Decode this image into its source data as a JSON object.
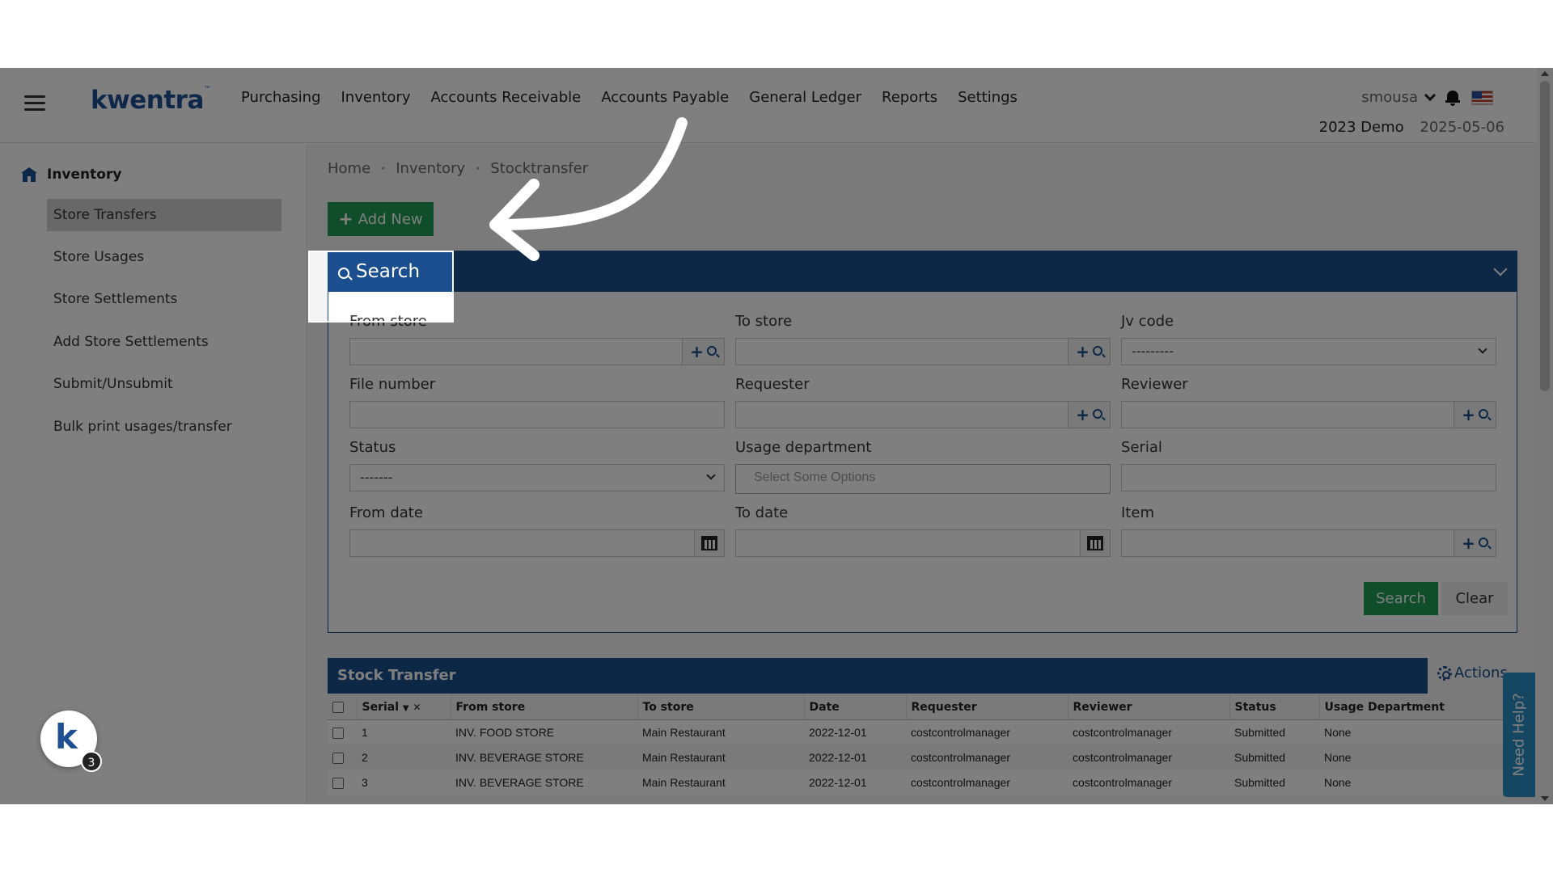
{
  "header": {
    "logo": "kwentra",
    "nav": [
      "Purchasing",
      "Inventory",
      "Accounts Receivable",
      "Accounts Payable",
      "General Ledger",
      "Reports",
      "Settings"
    ],
    "user": "smousa",
    "company": "2023 Demo",
    "date": "2025-05-06"
  },
  "sidebar": {
    "title": "Inventory",
    "items": [
      {
        "label": "Store Transfers",
        "active": true
      },
      {
        "label": "Store Usages"
      },
      {
        "label": "Store Settlements"
      },
      {
        "label": "Add Store Settlements"
      },
      {
        "label": "Submit/Unsubmit"
      },
      {
        "label": "Bulk print usages/transfer"
      }
    ]
  },
  "breadcrumb": [
    "Home",
    "Inventory",
    "Stocktransfer"
  ],
  "add_new_label": "Add New",
  "search": {
    "title": "Search",
    "fields": {
      "from_store": "From store",
      "to_store": "To store",
      "jv_code": "Jv code",
      "jv_code_value": "---------",
      "file_number": "File number",
      "requester": "Requester",
      "reviewer": "Reviewer",
      "status": "Status",
      "status_value": "-------",
      "usage_department": "Usage department",
      "usage_department_placeholder": "Select Some Options",
      "serial": "Serial",
      "from_date": "From date",
      "to_date": "To date",
      "item": "Item"
    },
    "search_button": "Search",
    "clear_button": "Clear"
  },
  "table": {
    "title": "Stock Transfer",
    "actions_label": "Actions",
    "columns": [
      "Serial",
      "From store",
      "To store",
      "Date",
      "Requester",
      "Reviewer",
      "Status",
      "Usage Department"
    ],
    "rows": [
      [
        "1",
        "INV. FOOD STORE",
        "Main Restaurant",
        "2022-12-01",
        "costcontrolmanager",
        "costcontrolmanager",
        "Submitted",
        "None"
      ],
      [
        "2",
        "INV. BEVERAGE STORE",
        "Main Restaurant",
        "2022-12-01",
        "costcontrolmanager",
        "costcontrolmanager",
        "Submitted",
        "None"
      ],
      [
        "3",
        "INV. BEVERAGE STORE",
        "Main Restaurant",
        "2022-12-01",
        "costcontrolmanager",
        "costcontrolmanager",
        "Submitted",
        "None"
      ]
    ]
  },
  "help_tab": "Need Help?",
  "bot_badge": "3",
  "colors": {
    "primary": "#1a4e8e",
    "green": "#1f9a57",
    "help": "#2a8fc4"
  }
}
